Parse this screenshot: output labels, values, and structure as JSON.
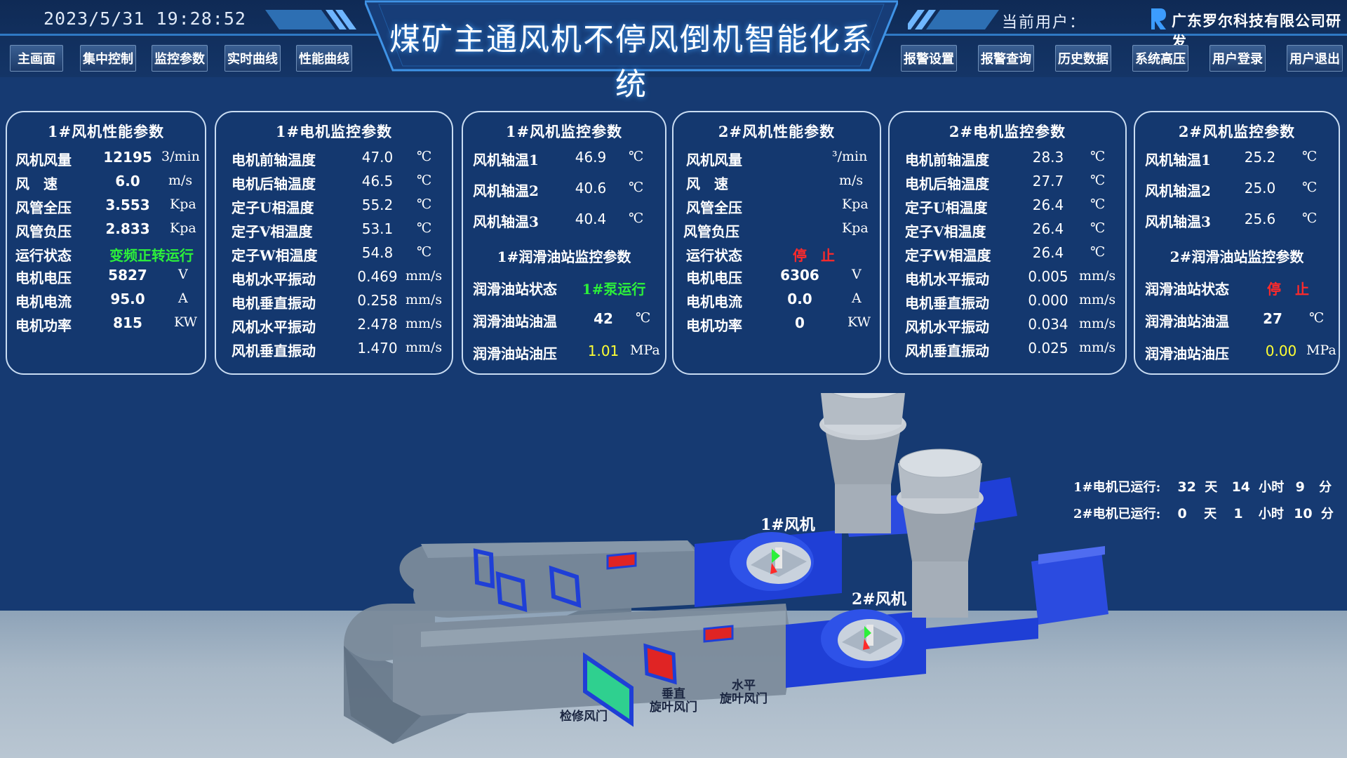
{
  "header": {
    "datetime": "2023/5/31  19:28:52",
    "title": "煤矿主通风机不停风倒机智能化系统",
    "current_user_label": "当前用户：",
    "company": "广东罗尔科技有限公司研发",
    "accent_color": "#2f79c4"
  },
  "nav_left": [
    "主画面",
    "集中控制",
    "监控参数",
    "实时曲线",
    "性能曲线"
  ],
  "nav_right": [
    "报警设置",
    "报警查询",
    "历史数据",
    "系统高压",
    "用户登录",
    "用户退出"
  ],
  "panels": {
    "fan1_perf": {
      "title": "1#风机性能参数",
      "rows": [
        {
          "label": "风机风量",
          "value": "12195",
          "unit": "3/min"
        },
        {
          "label": "风　速",
          "value": "6.0",
          "unit": "m/s"
        },
        {
          "label": "风管全压",
          "value": "3.553",
          "unit": "Kpa"
        },
        {
          "label": "风管负压",
          "value": "2.833",
          "unit": "Kpa"
        },
        {
          "label": "运行状态",
          "value": "变频正转运行",
          "unit": ""
        },
        {
          "label": "电机电压",
          "value": "5827",
          "unit": "V"
        },
        {
          "label": "电机电流",
          "value": "95.0",
          "unit": "A"
        },
        {
          "label": "电机功率",
          "value": "815",
          "unit": "KW"
        }
      ]
    },
    "motor1": {
      "title": "1#电机监控参数",
      "rows": [
        {
          "label": "电机前轴温度",
          "value": "47.0",
          "unit": "℃"
        },
        {
          "label": "电机后轴温度",
          "value": "46.5",
          "unit": "℃"
        },
        {
          "label": "定子U相温度",
          "value": "55.2",
          "unit": "℃"
        },
        {
          "label": "定子V相温度",
          "value": "53.1",
          "unit": "℃"
        },
        {
          "label": "定子W相温度",
          "value": "54.8",
          "unit": "℃"
        },
        {
          "label": "电机水平振动",
          "value": "0.469",
          "unit": "mm/s"
        },
        {
          "label": "电机垂直振动",
          "value": "0.258",
          "unit": "mm/s"
        },
        {
          "label": "风机水平振动",
          "value": "2.478",
          "unit": "mm/s"
        },
        {
          "label": "风机垂直振动",
          "value": "1.470",
          "unit": "mm/s"
        }
      ]
    },
    "fan1_mon": {
      "title": "1#风机监控参数",
      "rows": [
        {
          "label": "风机轴温1",
          "value": "46.9",
          "unit": "℃"
        },
        {
          "label": "风机轴温2",
          "value": "40.6",
          "unit": "℃"
        },
        {
          "label": "风机轴温3",
          "value": "40.4",
          "unit": "℃"
        }
      ],
      "oil_title": "1#润滑油站监控参数",
      "oil_rows": [
        {
          "label": "润滑油站状态",
          "value": "1#泵运行",
          "unit": ""
        },
        {
          "label": "润滑油站油温",
          "value": "42",
          "unit": "℃"
        },
        {
          "label": "润滑油站油压",
          "value": "1.01",
          "unit": "MPa"
        }
      ]
    },
    "fan2_perf": {
      "title": "2#风机性能参数",
      "rows": [
        {
          "label": "风机风量",
          "value": "",
          "unit": "³/min"
        },
        {
          "label": "风　速",
          "value": "",
          "unit": "m/s"
        },
        {
          "label": "风管全压",
          "value": "",
          "unit": "Kpa"
        },
        {
          "label": "风管负压",
          "value": "",
          "unit": "Kpa"
        },
        {
          "label": "运行状态",
          "value": "停　止",
          "unit": ""
        },
        {
          "label": "电机电压",
          "value": "6306",
          "unit": "V"
        },
        {
          "label": "电机电流",
          "value": "0.0",
          "unit": "A"
        },
        {
          "label": "电机功率",
          "value": "0",
          "unit": "KW"
        }
      ]
    },
    "motor2": {
      "title": "2#电机监控参数",
      "rows": [
        {
          "label": "电机前轴温度",
          "value": "28.3",
          "unit": "℃"
        },
        {
          "label": "电机后轴温度",
          "value": "27.7",
          "unit": "℃"
        },
        {
          "label": "定子U相温度",
          "value": "26.4",
          "unit": "℃"
        },
        {
          "label": "定子V相温度",
          "value": "26.4",
          "unit": "℃"
        },
        {
          "label": "定子W相温度",
          "value": "26.4",
          "unit": "℃"
        },
        {
          "label": "电机水平振动",
          "value": "0.005",
          "unit": "mm/s"
        },
        {
          "label": "电机垂直振动",
          "value": "0.000",
          "unit": "mm/s"
        },
        {
          "label": "风机水平振动",
          "value": "0.034",
          "unit": "mm/s"
        },
        {
          "label": "风机垂直振动",
          "value": "0.025",
          "unit": "mm/s"
        }
      ]
    },
    "fan2_mon": {
      "title": "2#风机监控参数",
      "rows": [
        {
          "label": "风机轴温1",
          "value": "25.2",
          "unit": "℃"
        },
        {
          "label": "风机轴温2",
          "value": "25.0",
          "unit": "℃"
        },
        {
          "label": "风机轴温3",
          "value": "25.6",
          "unit": "℃"
        }
      ],
      "oil_title": "2#润滑油站监控参数",
      "oil_rows": [
        {
          "label": "润滑油站状态",
          "value": "停　止",
          "unit": ""
        },
        {
          "label": "润滑油站油温",
          "value": "27",
          "unit": "℃"
        },
        {
          "label": "润滑油站油压",
          "value": "0.00",
          "unit": "MPa"
        }
      ]
    }
  },
  "runtime": {
    "motor1": {
      "label": "1#电机已运行:",
      "days": "32",
      "hours": "14",
      "minutes": "9"
    },
    "motor2": {
      "label": "2#电机已运行:",
      "days": "0",
      "hours": "1",
      "minutes": "10"
    },
    "day_unit": "天",
    "hour_unit": "小时",
    "minute_unit": "分"
  },
  "scene": {
    "fan1_label": "1#风机",
    "fan2_label": "2#风机",
    "door_maintenance": "检修风门",
    "door_vertical_line1": "垂直",
    "door_vertical_line2": "旋叶风门",
    "door_horizontal_line1": "水平",
    "door_horizontal_line2": "旋叶风门"
  },
  "colors": {
    "running": "#2cf03a",
    "stopped": "#ff2a2a",
    "highlight": "#ffff33"
  }
}
